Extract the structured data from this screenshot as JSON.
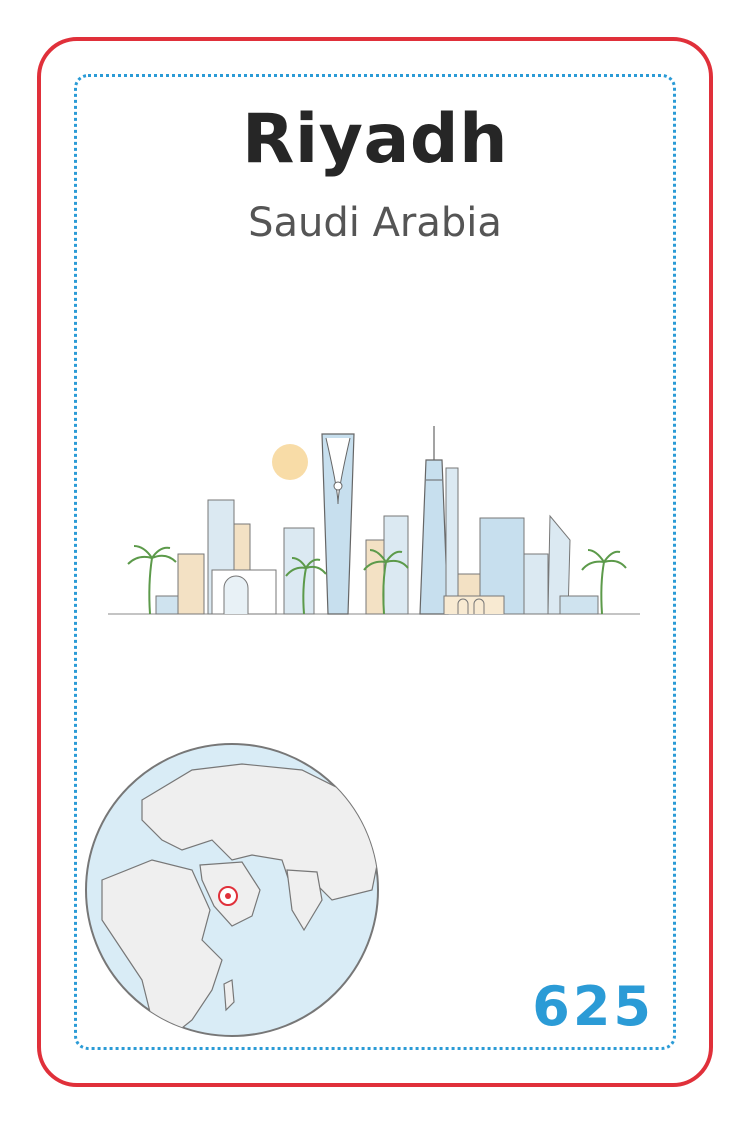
{
  "card": {
    "city": "Riyadh",
    "country": "Saudi Arabia",
    "number": "625"
  },
  "colors": {
    "border": "#e0303a",
    "inner_border": "#2b9bd6",
    "number": "#2b9bd6",
    "marker": "#e0303a"
  },
  "icons": {
    "skyline": "riyadh-skyline-illustration",
    "globe": "globe-map-icon",
    "marker": "location-marker-icon"
  }
}
